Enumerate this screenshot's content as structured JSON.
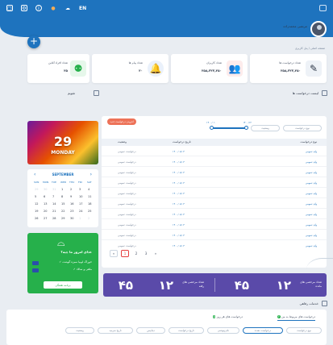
{
  "topbar": {
    "lang": "EN"
  },
  "header": {
    "user_name": "مرتضی محمدزاده",
    "user_role": "مدیر سیستم",
    "breadcrumb": "صفحه اصلی / پنل کاربری"
  },
  "stats": [
    {
      "label": "تعداد درخواست ها",
      "value": "۲۵۸,۳۲۳,۲۵۰"
    },
    {
      "label": "تعداد کاربران",
      "value": "۲۵۸,۳۲۳,۲۵۰"
    },
    {
      "label": "تعداد پیام ها",
      "value": "۲۰"
    },
    {
      "label": "تعداد افراد آنلاین",
      "value": "۲۵"
    }
  ],
  "calendar_section": {
    "title": "تقویم",
    "day_number": "29",
    "day_name": "MONDAY",
    "month": "SEPTEMBER",
    "weekdays": [
      "SUN",
      "MON",
      "TUE",
      "WED",
      "THU",
      "FRI",
      "SAT"
    ],
    "weeks": [
      [
        "29",
        "30",
        "31",
        "1",
        "2",
        "3",
        "4"
      ],
      [
        "5",
        "6",
        "7",
        "8",
        "9",
        "10",
        "11"
      ],
      [
        "12",
        "13",
        "14",
        "15",
        "16",
        "17",
        "18"
      ],
      [
        "19",
        "20",
        "21",
        "22",
        "23",
        "24",
        "25"
      ],
      [
        "26",
        "27",
        "28",
        "29",
        "30",
        "1",
        "2"
      ]
    ]
  },
  "requests": {
    "title": "لیست درخواست ها",
    "add_button": "افزودن درخواست جدید",
    "filter_type": "نوع درخواست",
    "filter_status": "وضعیت",
    "range_from": "۱۴۰۰/۰۱",
    "range_to": "۱۴۰۰/۱۲",
    "columns": [
      "نوع درخواست",
      "تاریخ درخواست",
      "وضعیت"
    ],
    "rows": [
      {
        "type": "وام عمومی",
        "date": "۱۴۰۰/۰۵/۰۴",
        "status": "درخواست عمومی"
      },
      {
        "type": "وام عمومی",
        "date": "۱۴۰۰/۰۵/۰۴",
        "status": "درخواست عمومی"
      },
      {
        "type": "وام عمومی",
        "date": "۱۴۰۰/۰۵/۰۴",
        "status": "درخواست عمومی"
      },
      {
        "type": "وام عمومی",
        "date": "۱۴۰۰/۰۵/۰۴",
        "status": "درخواست عمومی"
      },
      {
        "type": "وام عمومی",
        "date": "۱۴۰۰/۰۵/۰۴",
        "status": "درخواست عمومی"
      },
      {
        "type": "وام عمومی",
        "date": "۱۴۰۰/۰۵/۰۴",
        "status": "درخواست عمومی"
      },
      {
        "type": "وام عمومی",
        "date": "۱۴۰۰/۰۵/۰۴",
        "status": "درخواست عمومی"
      },
      {
        "type": "وام عمومی",
        "date": "۱۴۰۰/۰۵/۰۴",
        "status": "درخواست عمومی"
      },
      {
        "type": "وام عمومی",
        "date": "۱۴۰۰/۰۵/۰۴",
        "status": "درخواست عمومی"
      },
      {
        "type": "وام عمومی",
        "date": "۱۴۰۰/۰۵/۰۴",
        "status": "درخواست عمومی"
      }
    ],
    "pages": [
      "«",
      "1",
      "2",
      "3",
      "»"
    ],
    "active_page": "1"
  },
  "food": {
    "title": "غذای امروز ما چیه؟",
    "items": [
      "خوراک لوبیا سبزه گوشت",
      "ماهی و سالاد"
    ],
    "button": "برنامه هفتگی"
  },
  "summary": {
    "remaining_label": "تعداد مرخصی های مانده",
    "remaining_value": "۱۲",
    "used_label": "تعداد مرخصی های رفته",
    "used_value": "۱۲",
    "value_a": "۴۵",
    "value_b": "۴۵"
  },
  "bottom": {
    "title": "خدمات رفاهی",
    "tab_active": "درخواست های مربوط به من",
    "tab_active_count": "۴",
    "tab_other": "درخواست های هر روز",
    "tab_other_count": "۵",
    "filters": [
      "نوع درخواست",
      "درخواست دهنده",
      "نام ونوشتی",
      "تاریخ درخواست",
      "دیتابیس",
      "تاریخ سرمید",
      "وضعیت"
    ]
  },
  "colors": {
    "primary": "#1e73be",
    "accent": "#ed7258",
    "green": "#26b04b",
    "purple": "#5a4aa9"
  }
}
